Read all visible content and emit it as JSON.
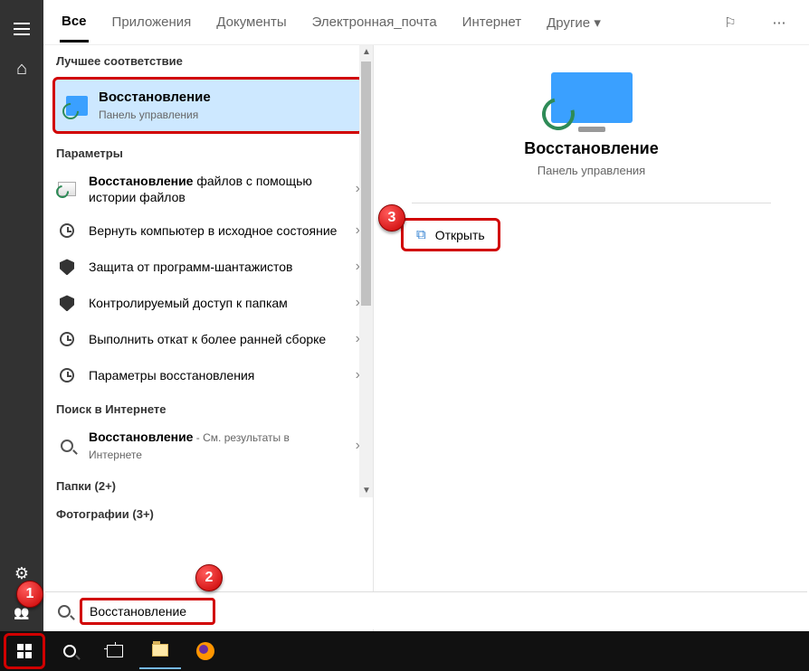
{
  "tabs": {
    "all": "Все",
    "apps": "Приложения",
    "documents": "Документы",
    "email": "Электронная_почта",
    "internet": "Интернет",
    "other": "Другие"
  },
  "sections": {
    "best_match": "Лучшее соответствие",
    "settings": "Параметры",
    "web_search": "Поиск в Интернете",
    "folders": "Папки (2+)",
    "photos": "Фотографии (3+)"
  },
  "best_match_item": {
    "title": "Восстановление",
    "subtitle": "Панель управления"
  },
  "settings_items": [
    {
      "main": "Восстановление",
      "rest": " файлов с помощью истории файлов",
      "icon": "recovery-file"
    },
    {
      "main": "",
      "rest": "Вернуть компьютер в исходное состояние",
      "icon": "clock"
    },
    {
      "main": "",
      "rest": "Защита от программ-шантажистов",
      "icon": "shield"
    },
    {
      "main": "",
      "rest": "Контролируемый доступ к папкам",
      "icon": "shield"
    },
    {
      "main": "",
      "rest": "Выполнить откат к более ранней сборке",
      "icon": "clock"
    },
    {
      "main": "",
      "rest": "Параметры восстановления",
      "icon": "clock"
    }
  ],
  "web_item": {
    "main": "Восстановление",
    "rest": " - См. результаты в Интернете"
  },
  "detail": {
    "title": "Восстановление",
    "subtitle": "Панель управления",
    "open": "Открыть"
  },
  "search_query": "Восстановление",
  "badges": {
    "one": "1",
    "two": "2",
    "three": "3"
  }
}
